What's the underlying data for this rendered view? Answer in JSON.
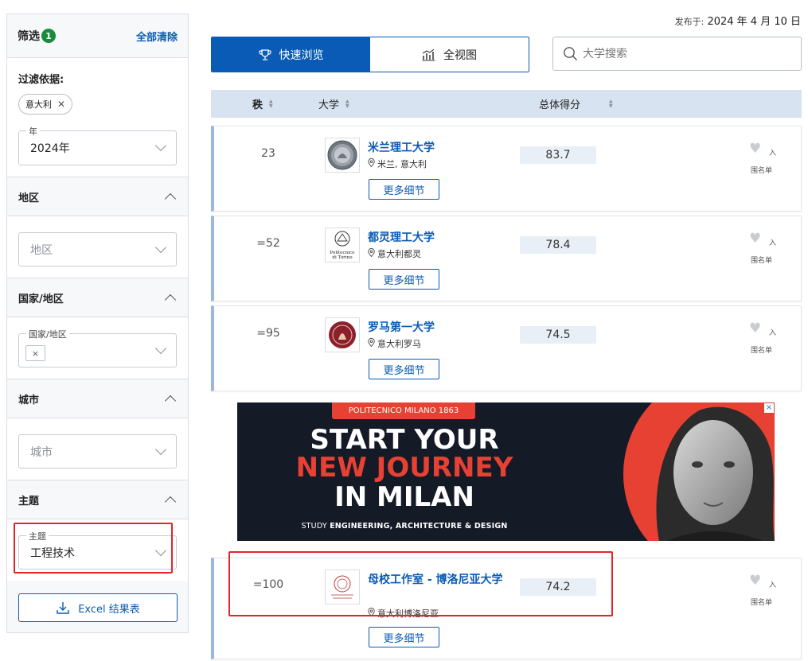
{
  "sidebar": {
    "title": "筛选",
    "filter_count": "1",
    "clear_all": "全部清除",
    "filter_by_label": "过滤依据:",
    "active_chip": "意大利",
    "year": {
      "legend": "年",
      "value": "2024年"
    },
    "region": {
      "title": "地区",
      "placeholder": "地区"
    },
    "country": {
      "title": "国家/地区",
      "legend": "国家/地区",
      "chip": "×"
    },
    "city": {
      "title": "城市",
      "placeholder": "城市"
    },
    "subject": {
      "title": "主题",
      "legend": "主题",
      "value": "工程技术"
    },
    "excel_button": "Excel 结果表"
  },
  "header": {
    "published_label": "发布于:",
    "published_date": "2024 年 4 月 10 日",
    "view_quick": "快速浏览",
    "view_full": "全视图",
    "search_placeholder": "大学搜索"
  },
  "table": {
    "col_rank": "秩",
    "col_university": "大学",
    "col_score": "总体得分",
    "more_label": "更多细节",
    "wishlist_line1": "入",
    "wishlist_line2": "围名单",
    "rows": [
      {
        "rank": "23",
        "name": "米兰理工大学",
        "location": "米兰, 意大利",
        "score": "83.7"
      },
      {
        "rank": "=52",
        "name": "都灵理工大学",
        "location": "意大利都灵",
        "score": "78.4"
      },
      {
        "rank": "=95",
        "name": "罗马第一大学",
        "location": "意大利罗马",
        "score": "74.5"
      },
      {
        "rank": "=100",
        "name": "母校工作室 - 博洛尼亚大学",
        "location": "意大利博洛尼亚",
        "score": "74.2"
      }
    ]
  },
  "ad": {
    "top_tag": "POLITECNICO MILANO 1863",
    "line1": "START YOUR",
    "line2": "NEW JOURNEY",
    "line3": "IN MILAN",
    "sub_prefix": "STUDY ",
    "sub_bold": "ENGINEERING, ARCHITECTURE & DESIGN",
    "close": "×"
  },
  "logos": {
    "torino_line1": "Politecnico",
    "torino_line2": "di Torino"
  },
  "colors": {
    "accent": "#0a5bb5",
    "highlight": "#e0262b",
    "ad_red": "#e64133"
  }
}
